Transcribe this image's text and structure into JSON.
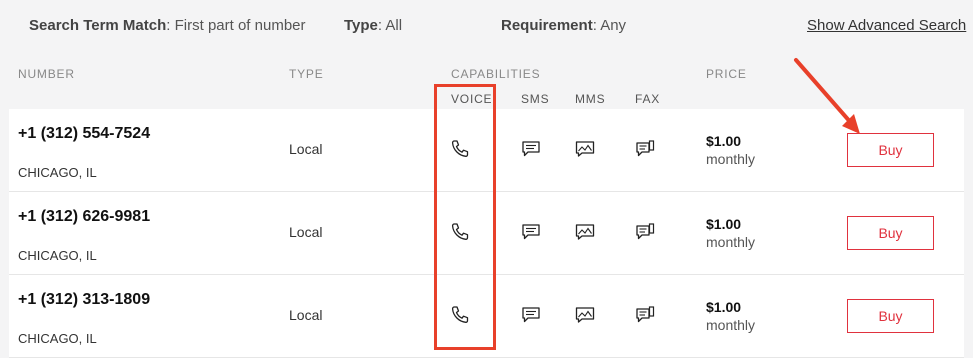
{
  "filters": {
    "term_label": "Search Term Match",
    "term_value": ": First part of number",
    "type_label": "Type",
    "type_value": ": All",
    "req_label": "Requirement",
    "req_value": ": Any",
    "advanced_link": "Show Advanced Search"
  },
  "headers": {
    "number": "NUMBER",
    "type": "TYPE",
    "capabilities": "CAPABILITIES",
    "price": "PRICE",
    "voice": "VOICE",
    "sms": "SMS",
    "mms": "MMS",
    "fax": "FAX"
  },
  "rows": [
    {
      "number": "+1 (312) 554-7524",
      "city": "CHICAGO, IL",
      "type": "Local",
      "price": "$1.00",
      "period": "monthly",
      "buy": "Buy"
    },
    {
      "number": "+1 (312) 626-9981",
      "city": "CHICAGO, IL",
      "type": "Local",
      "price": "$1.00",
      "period": "monthly",
      "buy": "Buy"
    },
    {
      "number": "+1 (312) 313-1809",
      "city": "CHICAGO, IL",
      "type": "Local",
      "price": "$1.00",
      "period": "monthly",
      "buy": "Buy"
    }
  ],
  "icons": {
    "voice": "phone-icon",
    "sms": "message-icon",
    "mms": "image-message-icon",
    "fax": "fax-icon"
  },
  "colors": {
    "accent": "#e0323e",
    "annotation": "#e8402a"
  }
}
